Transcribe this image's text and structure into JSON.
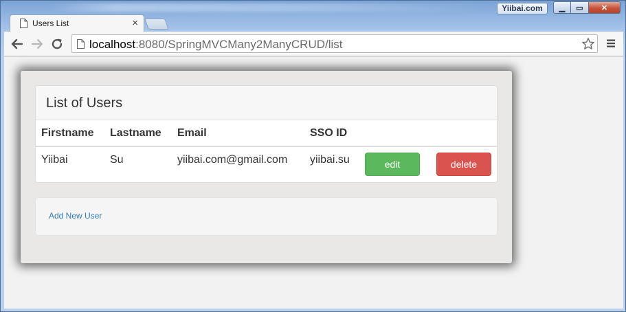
{
  "window": {
    "brand_badge": "Yiibai.com",
    "min_icon": "minimize-icon",
    "max_icon": "maximize-icon",
    "close_icon": "close-icon"
  },
  "browser": {
    "tab_title": "Users List",
    "tab_close": "×",
    "url_host": "localhost",
    "url_rest": ":8080/SpringMVCMany2ManyCRUD/list"
  },
  "page": {
    "panel_title": "List of Users",
    "columns": [
      "Firstname",
      "Lastname",
      "Email",
      "SSO ID"
    ],
    "rows": [
      {
        "firstname": "Yiibai",
        "lastname": "Su",
        "email": "yiibai.com@gmail.com",
        "sso_id": "yiibai.su",
        "edit_label": "edit",
        "delete_label": "delete"
      }
    ],
    "add_link": "Add New User"
  },
  "colors": {
    "edit_button": "#5cb85c",
    "delete_button": "#d9534f",
    "link": "#337ab7"
  }
}
